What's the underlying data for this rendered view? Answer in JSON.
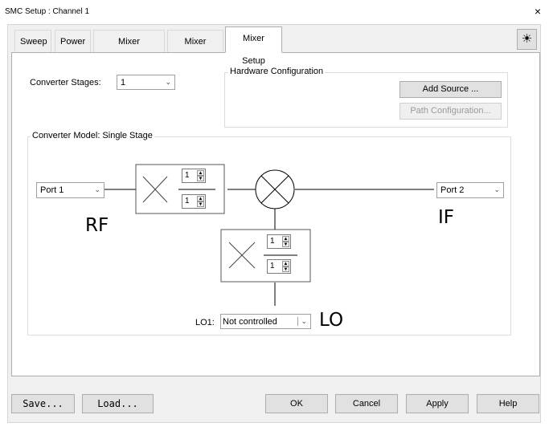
{
  "window": {
    "title": "SMC Setup : Channel 1",
    "close_glyph": "×"
  },
  "tabs": [
    {
      "label": "Sweep"
    },
    {
      "label": "Power"
    },
    {
      "label": "Mixer Frequency"
    },
    {
      "label": "Mixer Power"
    },
    {
      "label": "Mixer Setup",
      "active": true
    }
  ],
  "sun_icon": "☀",
  "converter_stages": {
    "label": "Converter Stages:",
    "value": "1"
  },
  "hardware": {
    "title": "Hardware Configuration",
    "add_source": "Add Source ...",
    "path_configuration": "Path Configuration..."
  },
  "model": {
    "title": "Converter Model: Single Stage",
    "port1": "Port 1",
    "port2": "Port 2",
    "rf_label": "RF",
    "if_label": "IF",
    "lo_label": "LO",
    "lo1_label": "LO1:",
    "lo1_value": "Not controlled",
    "rf_multiplier": {
      "numerator": "1",
      "denominator": "1"
    },
    "lo_multiplier": {
      "numerator": "1",
      "denominator": "1"
    }
  },
  "footer": {
    "save": "Save...",
    "load": "Load...",
    "ok": "OK",
    "cancel": "Cancel",
    "apply": "Apply",
    "help": "Help"
  },
  "colors": {
    "dialog_bg": "#f0f0f0",
    "panel_bg": "#ffffff",
    "border": "#adadad"
  }
}
